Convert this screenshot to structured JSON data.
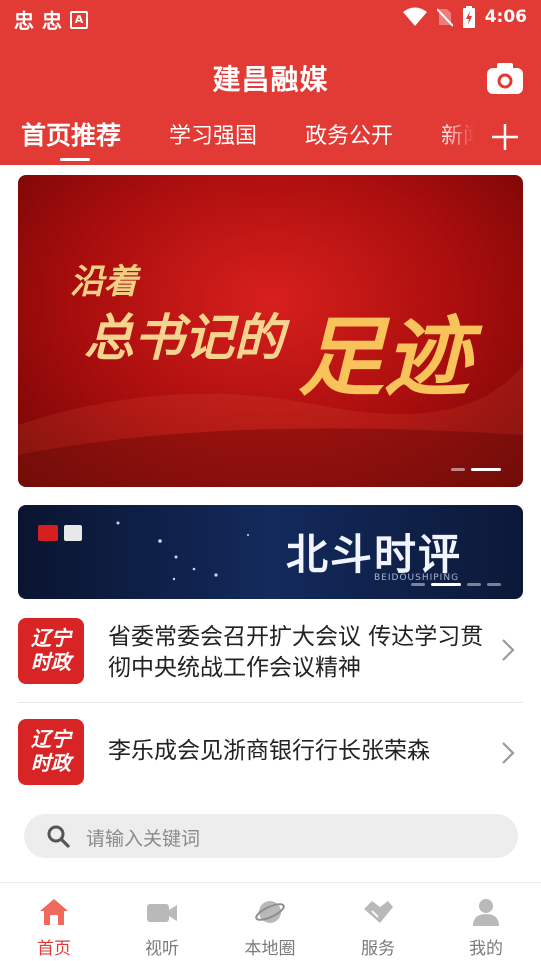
{
  "status_bar": {
    "time": "4:06",
    "notification_glyphs": [
      "忠",
      "忠"
    ],
    "app_icon_letter": "A"
  },
  "header": {
    "title": "建昌融媒"
  },
  "tabs": [
    {
      "label": "首页推荐",
      "active": true
    },
    {
      "label": "学习强国",
      "active": false
    },
    {
      "label": "政务公开",
      "active": false
    },
    {
      "label": "新闻",
      "active": false
    }
  ],
  "banner": {
    "line1": "沿着",
    "line2": "总书记的",
    "line3": "足迹",
    "slide_index": 2,
    "slide_count": 2
  },
  "banner2": {
    "title": "北斗时评",
    "subtitle": "BEIDOUSHIPING",
    "logo1": "北斗",
    "logo2": "N"
  },
  "news": [
    {
      "icon_text_top": "辽宁",
      "icon_text_bottom": "时政",
      "title": "省委常委会召开扩大会议 传达学习贯彻中央统战工作会议精神"
    },
    {
      "icon_text_top": "辽宁",
      "icon_text_bottom": "时政",
      "title": "李乐成会见浙商银行行长张荣森"
    }
  ],
  "search": {
    "placeholder": "请输入关键词"
  },
  "bottom_nav": [
    {
      "label": "首页",
      "icon": "home-icon",
      "active": true
    },
    {
      "label": "视听",
      "icon": "video-icon",
      "active": false
    },
    {
      "label": "本地圈",
      "icon": "planet-icon",
      "active": false
    },
    {
      "label": "服务",
      "icon": "handshake-icon",
      "active": false
    },
    {
      "label": "我的",
      "icon": "user-icon",
      "active": false
    }
  ],
  "colors": {
    "brand_red": "#e23a35",
    "nav_inactive": "#7b7b7b"
  }
}
